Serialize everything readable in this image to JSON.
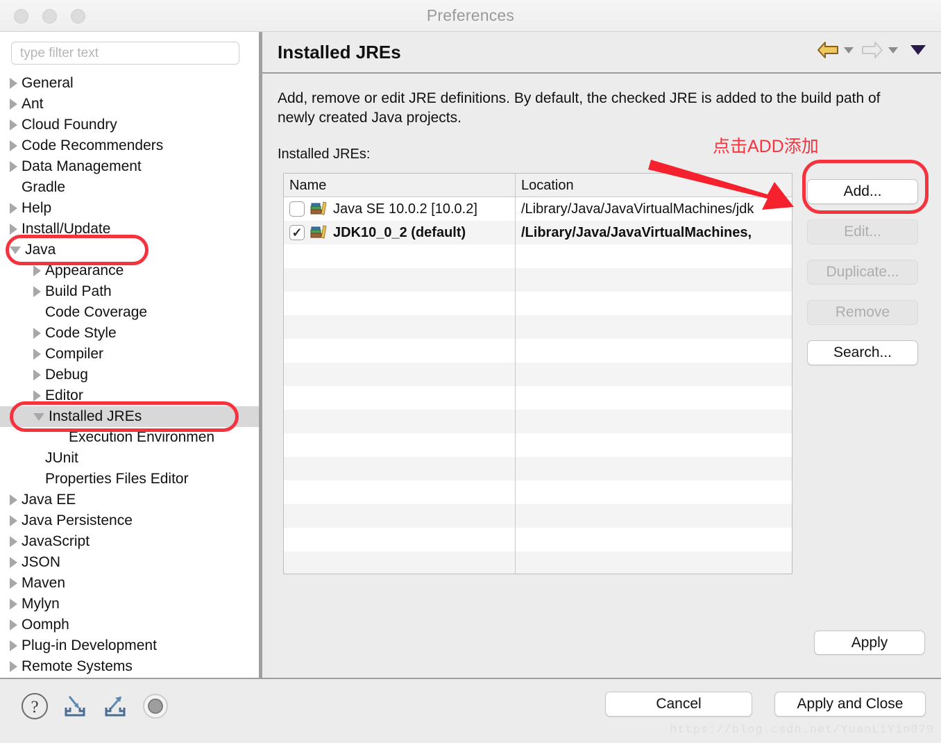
{
  "window": {
    "title": "Preferences",
    "traffic_lights": [
      "close-button",
      "minimize-button",
      "zoom-button"
    ]
  },
  "sidebar": {
    "filter": {
      "placeholder": "type filter text",
      "value": ""
    },
    "items": [
      {
        "label": "General",
        "indent": 0,
        "state": "closed",
        "selected": false
      },
      {
        "label": "Ant",
        "indent": 0,
        "state": "closed",
        "selected": false
      },
      {
        "label": "Cloud Foundry",
        "indent": 0,
        "state": "closed",
        "selected": false
      },
      {
        "label": "Code Recommenders",
        "indent": 0,
        "state": "closed",
        "selected": false
      },
      {
        "label": "Data Management",
        "indent": 0,
        "state": "closed",
        "selected": false
      },
      {
        "label": "Gradle",
        "indent": 0,
        "state": "leaf",
        "selected": false
      },
      {
        "label": "Help",
        "indent": 0,
        "state": "closed",
        "selected": false
      },
      {
        "label": "Install/Update",
        "indent": 0,
        "state": "closed",
        "selected": false
      },
      {
        "label": "Java",
        "indent": 0,
        "state": "open",
        "selected": false
      },
      {
        "label": "Appearance",
        "indent": 1,
        "state": "closed",
        "selected": false
      },
      {
        "label": "Build Path",
        "indent": 1,
        "state": "closed",
        "selected": false
      },
      {
        "label": "Code Coverage",
        "indent": 1,
        "state": "leaf",
        "selected": false
      },
      {
        "label": "Code Style",
        "indent": 1,
        "state": "closed",
        "selected": false
      },
      {
        "label": "Compiler",
        "indent": 1,
        "state": "closed",
        "selected": false
      },
      {
        "label": "Debug",
        "indent": 1,
        "state": "closed",
        "selected": false
      },
      {
        "label": "Editor",
        "indent": 1,
        "state": "closed",
        "selected": false
      },
      {
        "label": "Installed JREs",
        "indent": 1,
        "state": "open",
        "selected": true
      },
      {
        "label": "Execution Environmen",
        "indent": 2,
        "state": "leaf",
        "selected": false
      },
      {
        "label": "JUnit",
        "indent": 1,
        "state": "leaf",
        "selected": false
      },
      {
        "label": "Properties Files Editor",
        "indent": 1,
        "state": "leaf",
        "selected": false
      },
      {
        "label": "Java EE",
        "indent": 0,
        "state": "closed",
        "selected": false
      },
      {
        "label": "Java Persistence",
        "indent": 0,
        "state": "closed",
        "selected": false
      },
      {
        "label": "JavaScript",
        "indent": 0,
        "state": "closed",
        "selected": false
      },
      {
        "label": "JSON",
        "indent": 0,
        "state": "closed",
        "selected": false
      },
      {
        "label": "Maven",
        "indent": 0,
        "state": "closed",
        "selected": false
      },
      {
        "label": "Mylyn",
        "indent": 0,
        "state": "closed",
        "selected": false
      },
      {
        "label": "Oomph",
        "indent": 0,
        "state": "closed",
        "selected": false
      },
      {
        "label": "Plug-in Development",
        "indent": 0,
        "state": "closed",
        "selected": false
      },
      {
        "label": "Remote Systems",
        "indent": 0,
        "state": "closed",
        "selected": false
      }
    ]
  },
  "main": {
    "page_title": "Installed JREs",
    "description": "Add, remove or edit JRE definitions. By default, the checked JRE is added to the build path of newly created Java projects.",
    "list_label": "Installed JREs:",
    "nav": {
      "back_icon": "back-arrow-icon",
      "back_enabled": true,
      "forward_icon": "forward-arrow-icon",
      "forward_enabled": false,
      "menu_icon": "chevron-down-icon"
    },
    "table": {
      "columns": [
        "Name",
        "Location"
      ],
      "rows": [
        {
          "checked": false,
          "name": "Java SE 10.0.2 [10.0.2]",
          "location": "/Library/Java/JavaVirtualMachines/jdk",
          "bold": false
        },
        {
          "checked": true,
          "name": "JDK10_0_2 (default)",
          "location": "/Library/Java/JavaVirtualMachines,",
          "bold": true
        }
      ],
      "empty_row_count": 14
    },
    "buttons": [
      {
        "label": "Add...",
        "enabled": true
      },
      {
        "label": "Edit...",
        "enabled": false
      },
      {
        "label": "Duplicate...",
        "enabled": false
      },
      {
        "label": "Remove",
        "enabled": false
      },
      {
        "label": "Search...",
        "enabled": true
      }
    ],
    "apply_label": "Apply"
  },
  "bottom": {
    "icons": [
      "help-icon",
      "import-icon",
      "export-icon",
      "restore-defaults-icon"
    ],
    "cancel_label": "Cancel",
    "apply_and_close_label": "Apply and Close"
  },
  "annotations": {
    "callout_text": "点击ADD添加",
    "color": "#f5333f",
    "arrow": "red-arrow-icon",
    "boxes": [
      "java-tree-item",
      "installed-jres-tree-item",
      "add-button"
    ]
  },
  "watermark": "https://blog.csdn.net/YuanLiYin079"
}
